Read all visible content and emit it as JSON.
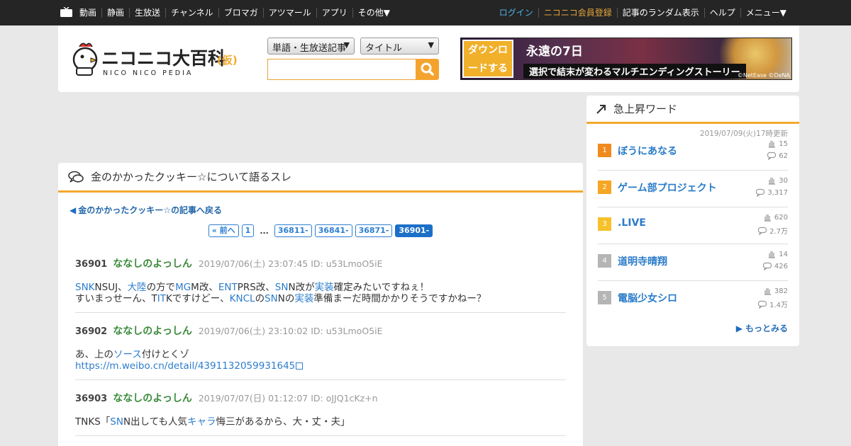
{
  "topnav": {
    "left": [
      "動画",
      "静画",
      "生放送",
      "チャンネル",
      "ブロマガ",
      "アツマール",
      "アプリ",
      "その他▼"
    ],
    "right": {
      "login": "ログイン",
      "premium": "ニコニコ会員登録",
      "random": "記事のランダム表示",
      "help": "ヘルプ",
      "menu": "メニュー▼"
    }
  },
  "header": {
    "logo_text": "ニコニコ大百科",
    "logo_paren": "(仮)",
    "logo_sub": "NICO NICO PEDIA",
    "search_type": "単語・生放送記事",
    "search_field": "タイトル",
    "search_value": "",
    "banner": {
      "download": "ダウンロードする",
      "title": "永遠の7日",
      "sub": "選択で結末が変わるマルチエンディングストーリー",
      "credit": "©NetEase ©DeNA"
    }
  },
  "thread": {
    "title": "金のかかったクッキー☆について語るスレ",
    "back_link": "金のかかったクッキー☆の記事へ戻る",
    "pager": {
      "prev": "« 前へ",
      "first": "1",
      "dots": "...",
      "pages": [
        "36811-",
        "36841-",
        "36871-"
      ],
      "current": "36901-"
    },
    "posts": [
      {
        "num": "36901",
        "name": "ななしのよっしん",
        "date": "2019/07/06(土) 23:07:45 ID: u53LmoO5iE",
        "line1": [
          [
            "SNK",
            "kw"
          ],
          [
            "NSUJ、",
            ""
          ],
          [
            "大陸",
            "kw"
          ],
          [
            "の方で",
            ""
          ],
          [
            "MG",
            "kw"
          ],
          [
            "M改、",
            ""
          ],
          [
            "ENT",
            "kw"
          ],
          [
            "PRS改、",
            ""
          ],
          [
            "SN",
            "kw"
          ],
          [
            "N改が",
            ""
          ],
          [
            "実装",
            "kw"
          ],
          [
            "確定みたいですねぇ！",
            ""
          ]
        ],
        "line2": [
          [
            "すいまっせーん、T",
            ""
          ],
          [
            "IT",
            "kw"
          ],
          [
            "Kですけどー、",
            ""
          ],
          [
            "KNCL",
            "kw"
          ],
          [
            "の",
            ""
          ],
          [
            "SN",
            "kw"
          ],
          [
            "Nの",
            ""
          ],
          [
            "実装",
            "kw"
          ],
          [
            "準備まーだ時間かかりそうですかねー？",
            ""
          ]
        ]
      },
      {
        "num": "36902",
        "name": "ななしのよっしん",
        "date": "2019/07/06(土) 23:10:02 ID: u53LmoO5iE",
        "line1": [
          [
            "あ、上の",
            ""
          ],
          [
            "ソース",
            "kw"
          ],
          [
            "付けとくゾ",
            ""
          ]
        ],
        "link": "https://m.weibo.cn/detail/4391132059931645"
      },
      {
        "num": "36903",
        "name": "ななしのよっしん",
        "date": "2019/07/07(日) 01:12:07 ID: oJJQ1cKz+n",
        "line1": [
          [
            "TNKS「",
            ""
          ],
          [
            "SN",
            "kw"
          ],
          [
            "N出しても人気",
            ""
          ],
          [
            "キャラ",
            "kw"
          ],
          [
            "悔三があるから、大・丈・夫」",
            ""
          ]
        ]
      }
    ]
  },
  "sidebar": {
    "title": "急上昇ワード",
    "updated": "2019/07/09(火)17時更新",
    "more": "もっとみる",
    "ranks": [
      {
        "rank": "1",
        "word": "ぼうにあなる",
        "hits": "15",
        "comments": "62",
        "color": "#f08a1c"
      },
      {
        "rank": "2",
        "word": "ゲーム部プロジェクト",
        "hits": "30",
        "comments": "3,317",
        "color": "#f5a623"
      },
      {
        "rank": "3",
        "word": ".LIVE",
        "hits": "620",
        "comments": "2.7万",
        "color": "#f7c12b"
      },
      {
        "rank": "4",
        "word": "道明寺晴翔",
        "hits": "14",
        "comments": "426",
        "color": "#b5b5b5"
      },
      {
        "rank": "5",
        "word": "電脳少女シロ",
        "hits": "382",
        "comments": "1.4万",
        "color": "#b5b5b5"
      }
    ]
  }
}
